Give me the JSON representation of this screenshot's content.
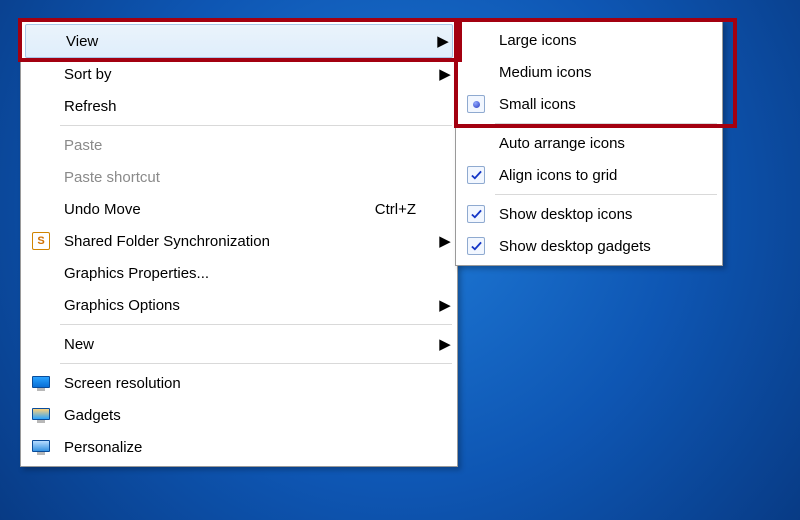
{
  "context_menu": {
    "items": [
      {
        "label": "View",
        "has_submenu": true,
        "highlighted": true
      },
      {
        "label": "Sort by",
        "has_submenu": true
      },
      {
        "label": "Refresh"
      },
      {
        "separator": true
      },
      {
        "label": "Paste",
        "disabled": true
      },
      {
        "label": "Paste shortcut",
        "disabled": true
      },
      {
        "label": "Undo Move",
        "accelerator": "Ctrl+Z"
      },
      {
        "label": "Shared Folder Synchronization",
        "has_submenu": true,
        "icon": "s-badge"
      },
      {
        "label": "Graphics Properties..."
      },
      {
        "label": "Graphics Options",
        "has_submenu": true
      },
      {
        "separator": true
      },
      {
        "label": "New",
        "has_submenu": true
      },
      {
        "separator": true
      },
      {
        "label": "Screen resolution",
        "icon": "monitor"
      },
      {
        "label": "Gadgets",
        "icon": "monitor-gadgets"
      },
      {
        "label": "Personalize",
        "icon": "monitor-alt"
      }
    ]
  },
  "view_submenu": {
    "items": [
      {
        "label": "Large icons"
      },
      {
        "label": "Medium icons"
      },
      {
        "label": "Small icons",
        "radio": true,
        "selected": true
      },
      {
        "separator": true
      },
      {
        "label": "Auto arrange icons"
      },
      {
        "label": "Align icons to grid",
        "check": true,
        "selected": true
      },
      {
        "separator": true
      },
      {
        "label": "Show desktop icons",
        "check": true,
        "selected": true
      },
      {
        "label": "Show desktop gadgets",
        "check": true,
        "selected": true
      }
    ]
  },
  "highlight_color": "#a30010",
  "arrow_glyph": "▶",
  "s_badge_letter": "S"
}
